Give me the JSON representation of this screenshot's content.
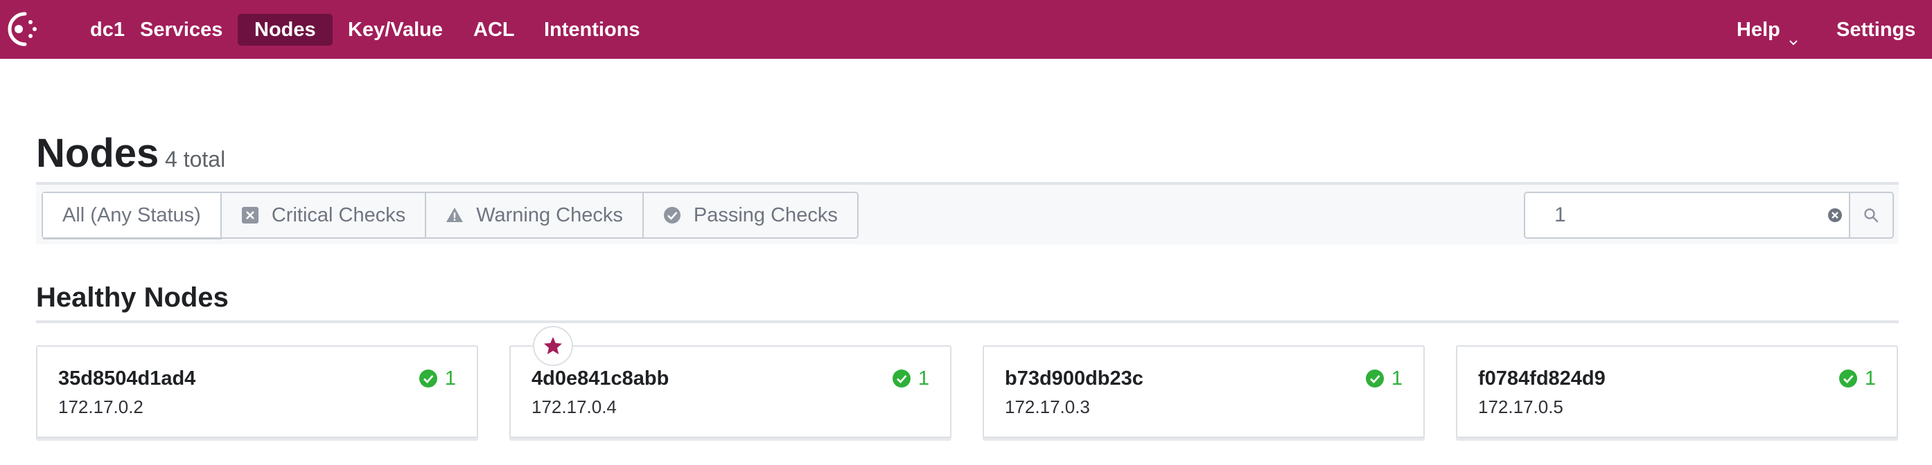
{
  "nav": {
    "logo_icon": "consul-logo-icon",
    "dc": "dc1",
    "items": [
      "Services",
      "Nodes",
      "Key/Value",
      "ACL",
      "Intentions"
    ],
    "active": "Nodes",
    "help": "Help",
    "settings": "Settings"
  },
  "page": {
    "title": "Nodes",
    "count": "4 total"
  },
  "filters": {
    "tabs": [
      {
        "label": "All (Any Status)",
        "icon": null,
        "selected": true
      },
      {
        "label": "Critical Checks",
        "icon": "critical-x-icon"
      },
      {
        "label": "Warning Checks",
        "icon": "warning-triangle-icon"
      },
      {
        "label": "Passing Checks",
        "icon": "passing-check-icon"
      }
    ],
    "search_value": "1"
  },
  "section": {
    "title": "Healthy Nodes"
  },
  "nodes": [
    {
      "name": "35d8504d1ad4",
      "address": "172.17.0.2",
      "passing": "1",
      "leader": false
    },
    {
      "name": "4d0e841c8abb",
      "address": "172.17.0.4",
      "passing": "1",
      "leader": true
    },
    {
      "name": "b73d900db23c",
      "address": "172.17.0.3",
      "passing": "1",
      "leader": false
    },
    {
      "name": "f0784fd824d9",
      "address": "172.17.0.5",
      "passing": "1",
      "leader": false
    }
  ],
  "colors": {
    "brand": "#a21e59",
    "brand_dark": "#6d1240",
    "passing": "#2eb039"
  }
}
